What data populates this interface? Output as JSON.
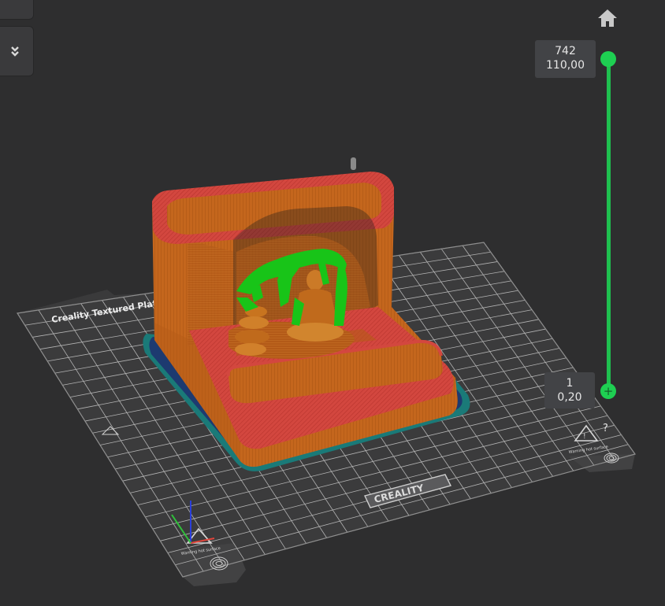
{
  "toolbar": {
    "expand_icon": "double-chevron-down-icon",
    "home_icon": "home-icon"
  },
  "layer_slider": {
    "top": {
      "layer": "742",
      "height": "110,00"
    },
    "bottom": {
      "layer": "1",
      "height": "0,20"
    },
    "track_color": "#1fc04f",
    "handle_color": "#1ecf52",
    "plus_label": "+"
  },
  "help_label": "?",
  "build_plate": {
    "label": "Creality Textured Plate",
    "brand": "CREALITY",
    "warning_label": "Warning hot surface",
    "plate_color": "#3b3b3c",
    "grid_color": "#b9b9b9"
  },
  "model_colors": {
    "outer_wall": "#c86a1e",
    "top_surface": "#d2433f",
    "support": "#18c418",
    "brim_blue": "#1d3a70",
    "brim_teal": "#1a7a78"
  }
}
